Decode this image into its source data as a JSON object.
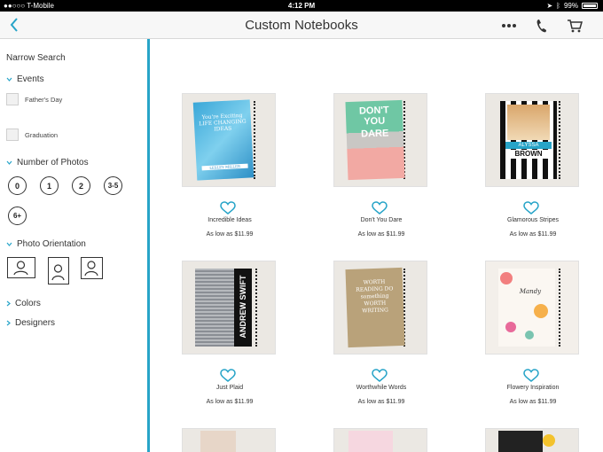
{
  "status": {
    "carrier": "●●○○○ T-Mobile",
    "time": "4:12 PM",
    "battery": "99%"
  },
  "nav": {
    "title": "Custom Notebooks",
    "icons": [
      "back-chevron-icon",
      "more-icon",
      "phone-icon",
      "cart-icon"
    ]
  },
  "sidebar": {
    "heading": "Narrow Search",
    "events": {
      "label": "Events",
      "options": [
        "Father's Day",
        "Graduation"
      ]
    },
    "photos": {
      "label": "Number of Photos",
      "options": [
        "0",
        "1",
        "2",
        "3-5",
        "6+"
      ]
    },
    "orientation": {
      "label": "Photo Orientation",
      "options": [
        "landscape",
        "portrait",
        "square"
      ]
    },
    "colors_label": "Colors",
    "designers_label": "Designers"
  },
  "theme": {
    "accent": "#27a4c8",
    "heart": "#27a4c8"
  },
  "products": [
    {
      "name": "Incredible Ideas",
      "price": "As low as $11.99"
    },
    {
      "name": "Don't You Dare",
      "price": "As low as $11.99"
    },
    {
      "name": "Glamorous Stripes",
      "price": "As low as $11.99"
    },
    {
      "name": "Just Plaid",
      "price": "As low as $11.99"
    },
    {
      "name": "Worthwhile Words",
      "price": "As low as $11.99"
    },
    {
      "name": "Flowery Inspiration",
      "price": "As low as $11.99"
    }
  ],
  "cover_text": {
    "p1": "You're Exciting LIFE CHANGING IDEAS",
    "p1_byline": "LESLEY MILLER",
    "p2_line1": "DON'T",
    "p2_line2": "YOU",
    "p2_line3": "DARE",
    "p3_name1": "ALYSSA",
    "p3_name2": "BROWN",
    "p4_name": "ANDREW SWIFT",
    "p5": "WORTH READING DO something WORTH WRITING",
    "p6": "Mandy"
  }
}
